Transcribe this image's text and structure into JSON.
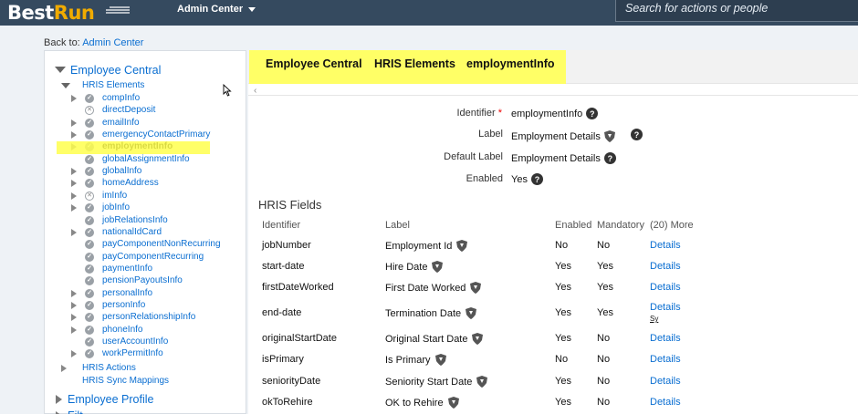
{
  "header": {
    "logo_best": "Best",
    "logo_run": "Run",
    "admin_center": "Admin Center",
    "search_placeholder": "Search for actions or people"
  },
  "back": {
    "prefix": "Back to:",
    "link": "Admin Center"
  },
  "tree": {
    "employee_central": "Employee Central",
    "hris_elements": "HRIS Elements",
    "items": [
      {
        "label": "compInfo",
        "status": "check",
        "expandable": true
      },
      {
        "label": "directDeposit",
        "status": "x",
        "expandable": false
      },
      {
        "label": "emailInfo",
        "status": "check",
        "expandable": true
      },
      {
        "label": "emergencyContactPrimary",
        "status": "check",
        "expandable": true
      },
      {
        "label": "employmentInfo",
        "status": "check",
        "expandable": true,
        "selected": true
      },
      {
        "label": "globalAssignmentInfo",
        "status": "check",
        "expandable": false
      },
      {
        "label": "globalInfo",
        "status": "check",
        "expandable": true
      },
      {
        "label": "homeAddress",
        "status": "check",
        "expandable": true
      },
      {
        "label": "imInfo",
        "status": "x",
        "expandable": true
      },
      {
        "label": "jobInfo",
        "status": "check",
        "expandable": true
      },
      {
        "label": "jobRelationsInfo",
        "status": "check",
        "expandable": false
      },
      {
        "label": "nationalIdCard",
        "status": "check",
        "expandable": true
      },
      {
        "label": "payComponentNonRecurring",
        "status": "check",
        "expandable": false
      },
      {
        "label": "payComponentRecurring",
        "status": "check",
        "expandable": false
      },
      {
        "label": "paymentInfo",
        "status": "check",
        "expandable": false
      },
      {
        "label": "pensionPayoutsInfo",
        "status": "check",
        "expandable": false
      },
      {
        "label": "personalInfo",
        "status": "check",
        "expandable": true
      },
      {
        "label": "personInfo",
        "status": "check",
        "expandable": true
      },
      {
        "label": "personRelationshipInfo",
        "status": "check",
        "expandable": true
      },
      {
        "label": "phoneInfo",
        "status": "check",
        "expandable": true
      },
      {
        "label": "userAccountInfo",
        "status": "check",
        "expandable": false
      },
      {
        "label": "workPermitInfo",
        "status": "check",
        "expandable": true
      }
    ],
    "hris_actions": "HRIS Actions",
    "hris_sync": "HRIS Sync Mappings",
    "employee_profile": "Employee Profile",
    "partial_next": "Filt"
  },
  "breadcrumb": [
    "Employee Central",
    "HRIS Elements",
    "employmentInfo"
  ],
  "details": {
    "identifier_label": "Identifier",
    "required_mark": "*",
    "identifier_value": "employmentInfo",
    "label_label": "Label",
    "label_value": "Employment Details",
    "default_label_label": "Default Label",
    "default_label_value": "Employment Details",
    "enabled_label": "Enabled",
    "enabled_value": "Yes",
    "help_glyph": "?"
  },
  "fields": {
    "title": "HRIS Fields",
    "columns": [
      "Identifier",
      "Label",
      "Enabled",
      "Mandatory",
      "(20) More"
    ],
    "rows": [
      {
        "identifier": "jobNumber",
        "label": "Employment Id",
        "enabled": "No",
        "mandatory": "No",
        "more": "Details"
      },
      {
        "identifier": "start-date",
        "label": "Hire Date",
        "enabled": "Yes",
        "mandatory": "Yes",
        "more": "Details"
      },
      {
        "identifier": "firstDateWorked",
        "label": "First Date Worked",
        "enabled": "Yes",
        "mandatory": "Yes",
        "more": "Details"
      },
      {
        "identifier": "end-date",
        "label": "Termination Date",
        "enabled": "Yes",
        "mandatory": "Yes",
        "more": "Details",
        "note": "Sy"
      },
      {
        "identifier": "originalStartDate",
        "label": "Original Start Date",
        "enabled": "Yes",
        "mandatory": "No",
        "more": "Details"
      },
      {
        "identifier": "isPrimary",
        "label": "Is Primary",
        "enabled": "No",
        "mandatory": "No",
        "more": "Details"
      },
      {
        "identifier": "seniorityDate",
        "label": "Seniority Start Date",
        "enabled": "Yes",
        "mandatory": "No",
        "more": "Details"
      },
      {
        "identifier": "okToRehire",
        "label": "OK to Rehire",
        "enabled": "Yes",
        "mandatory": "No",
        "more": "Details"
      }
    ]
  },
  "colors": {
    "header": "#354a5f",
    "accent": "#0a6ed1",
    "logo_run": "#f0ab00",
    "highlight": "#ffff66"
  }
}
